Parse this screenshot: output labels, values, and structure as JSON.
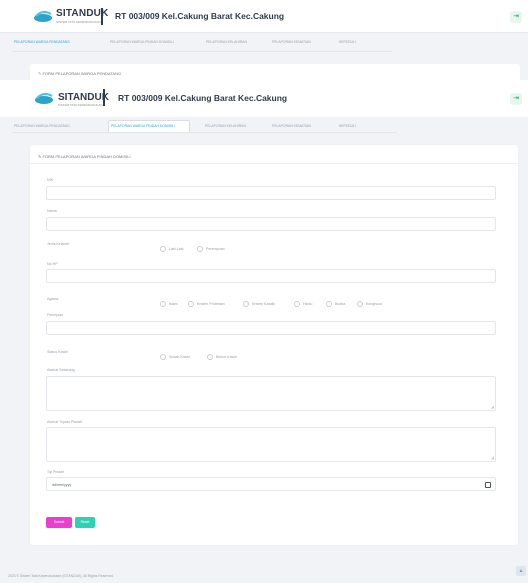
{
  "app": {
    "logo_text": "SITANDUK",
    "logo_sub": "SISTEM TATA KEPENDUDUKAN",
    "title": "RT 003/009 Kel.Cakung Barat Kec.Cakung"
  },
  "tabs_back": [
    {
      "label": "PELAPORAN WARGA PENDATANG"
    },
    {
      "label": "PELAPORAN WARGA PINDAH DOMISILI"
    },
    {
      "label": "PELAPORAN KELAHIRAN"
    },
    {
      "label": "PELAPORAN KEMATIAN"
    },
    {
      "label": "KEPEDULI"
    }
  ],
  "back_card_title": "FORM PELAPORAN WARGA PENDATANG",
  "tabs": [
    {
      "label": "PELAPORAN WARGA PENDATANG"
    },
    {
      "label": "PELAPORAN WARGA PINDAH DOMISILI"
    },
    {
      "label": "PELAPORAN KELAHIRAN"
    },
    {
      "label": "PELAPORAN KEMATIAN"
    },
    {
      "label": "KEPEDULI"
    }
  ],
  "form": {
    "title": "FORM PELAPORAN WARGA PINDAH DOMISILI",
    "nik_label": "NIK",
    "nama_label": "Nama",
    "jk_label": "Jenis Kelamin",
    "jk_options": [
      "Laki-Laki",
      "Perempuan"
    ],
    "nohp_label": "No HP",
    "agama_label": "Agama",
    "agama_options": [
      "Islam",
      "Kristen Protestan",
      "Kristen Katolik",
      "Hindu",
      "Budha",
      "Konghucu"
    ],
    "pekerjaan_label": "Pekerjaan",
    "status_label": "Status Kawin",
    "status_options": [
      "Sudah Kawin",
      "Belum Kawin"
    ],
    "alamat_sekarang_label": "Alamat Sekarang",
    "alamat_tujuan_label": "Alamat Tujuan Pindah",
    "tgl_label": "Tgl Pindah",
    "tgl_value": "dd/mm/yyyy",
    "submit_label": "Submit",
    "reset_label": "Reset"
  },
  "footer": "2023 © Sistem Tata Kependudukan (SITANDUK). All Rights Reserved.",
  "icons": {
    "logout": "logout-icon",
    "pencil": "pencil-icon",
    "calendar": "calendar-icon",
    "arrow_up": "arrow-up-icon"
  },
  "colors": {
    "accent": "#2aa4c9",
    "submit": "#ea3ecf",
    "reset": "#2fd0b3",
    "brand": "#2f3b4c"
  }
}
